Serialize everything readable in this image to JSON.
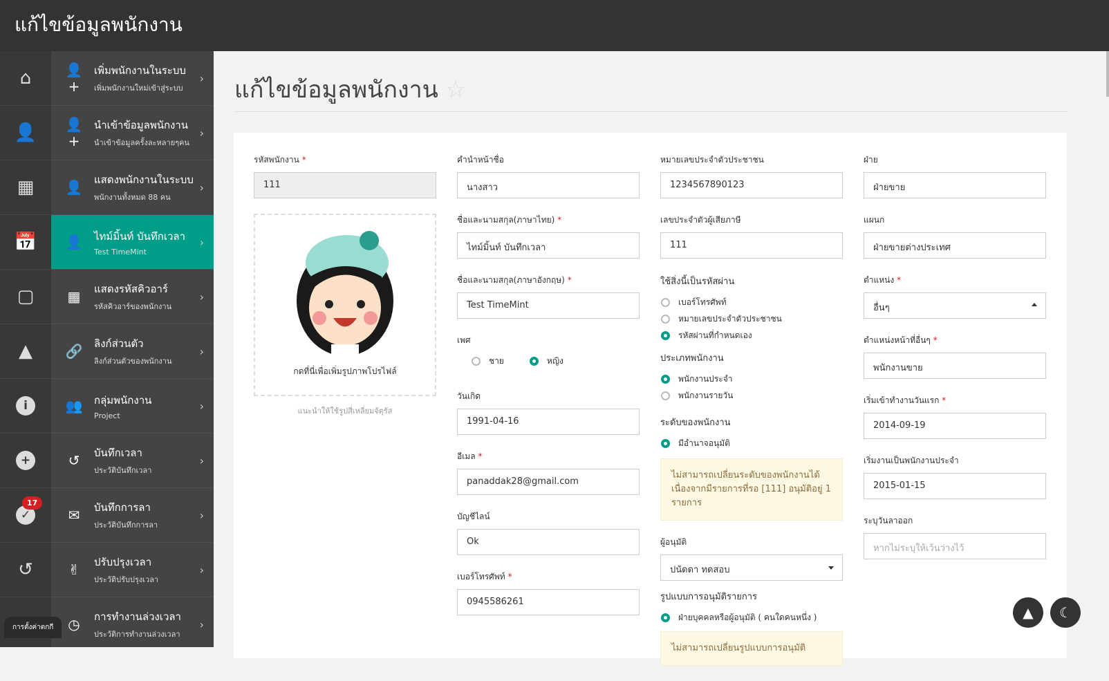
{
  "header": {
    "title": "แก้ไขข้อมูลพนักงาน"
  },
  "iconbar": {
    "badge": "17"
  },
  "menu": [
    {
      "title": "เพิ่มพนักงานในระบบ",
      "sub": "เพิ่มพนักงานใหม่เข้าสู่ระบบ",
      "icon": "👤+"
    },
    {
      "title": "นำเข้าข้อมูลพนักงาน",
      "sub": "นำเข้าข้อมูลครั้งละหลายๆคน",
      "icon": "👤+"
    },
    {
      "title": "แสดงพนักงานในระบบ",
      "sub": "พนักงานทั้งหมด 88 คน",
      "icon": "👤"
    },
    {
      "title": "ไทม์มิ้นท์ บันทึกเวลา",
      "sub": "Test TimeMint",
      "icon": "👤"
    },
    {
      "title": "แสดงรหัสคิวอาร์",
      "sub": "รหัสคิวอาร์ของพนักงาน",
      "icon": "▦"
    },
    {
      "title": "ลิงก์ส่วนตัว",
      "sub": "ลิงก์ส่วนตัวของพนักงาน",
      "icon": "🔗"
    },
    {
      "title": "กลุ่มพนักงาน",
      "sub": "Project",
      "icon": "👥"
    },
    {
      "title": "บันทึกเวลา",
      "sub": "ประวัติบันทึกเวลา",
      "icon": "↺"
    },
    {
      "title": "บันทึกการลา",
      "sub": "ประวัติบันทึกการลา",
      "icon": "✉"
    },
    {
      "title": "ปรับปรุงเวลา",
      "sub": "ประวัติปรับปรุงเวลา",
      "icon": "✌"
    },
    {
      "title": "การทำงานล่วงเวลา",
      "sub": "ประวัติการทำงานล่วงเวลา",
      "icon": "◷"
    }
  ],
  "tooltip": "การตั้งค่าตกกี",
  "page": {
    "title": "แก้ไขข้อมูลพนักงาน"
  },
  "form": {
    "emp_code": {
      "label": "รหัสพนักงาน",
      "value": "111"
    },
    "photo_text": "กดที่นี่เพื่อเพิ่มรูปภาพโปรไฟล์",
    "photo_hint": "แนะนำให้ใช้รูปสี่เหลี่ยมจัตุรัส",
    "prefix": {
      "label": "คำนำหน้าชื่อ",
      "value": "นางสาว"
    },
    "name_th": {
      "label": "ชื่อและนามสกุล(ภาษาไทย)",
      "value": "ไทม์มิ้นท์ บันทึกเวลา"
    },
    "name_en": {
      "label": "ชื่อและนามสกุล(ภาษาอังกฤษ)",
      "value": "Test TimeMint"
    },
    "gender": {
      "label": "เพศ",
      "male": "ชาย",
      "female": "หญิง"
    },
    "birthday": {
      "label": "วันเกิด",
      "value": "1991-04-16"
    },
    "email": {
      "label": "อีเมล",
      "value": "panaddak28@gmail.com"
    },
    "line": {
      "label": "บัญชีไลน์",
      "value": "Ok"
    },
    "phone": {
      "label": "เบอร์โทรศัพท์",
      "value": "0945586261"
    },
    "national_id": {
      "label": "หมายเลขประจำตัวประชาชน",
      "value": "1234567890123"
    },
    "tax_id": {
      "label": "เลขประจำตัวผู้เสียภาษี",
      "value": "111"
    },
    "password": {
      "label": "ใช้สิ่งนี้เป็นรหัสผ่าน",
      "options": [
        "เบอร์โทรศัพท์",
        "หมายเลขประจำตัวประชาชน",
        "รหัสผ่านที่กำหนดเอง"
      ]
    },
    "emp_type": {
      "label": "ประเภทพนักงาน",
      "options": [
        "พนักงานประจำ",
        "พนักงานรายวัน"
      ]
    },
    "level": {
      "label": "ระดับของพนักงาน",
      "option": "มีอำนาจอนุมัติ"
    },
    "level_warn": {
      "line1": "ไม่สามารถเปลี่ยนระดับของพนักงานได้",
      "line2": "เนื่องจากมีรายการที่รอ [111] อนุมัติอยู่ 1 รายการ"
    },
    "approver": {
      "label": "ผู้อนุมัติ",
      "value": "ปนัดดา ทดสอบ"
    },
    "approval_type": {
      "label": "รูปแบบการอนุมัติรายการ",
      "option": "ฝ่ายบุคคลหรือผู้อนุมัติ ( คนใดคนหนึ่ง )"
    },
    "approval_warn": "ไม่สามารถเปลี่ยนรูปแบบการอนุมัติ",
    "department": {
      "label": "ฝ่าย",
      "value": "ฝ่ายขาย"
    },
    "section": {
      "label": "แผนก",
      "value": "ฝ่ายขายต่างประเทศ"
    },
    "position": {
      "label": "ตำแหน่ง",
      "value": "อื่นๆ"
    },
    "position_other": {
      "label": "ตำแหน่งหน้าที่อื่นๆ",
      "value": "พนักงานขาย"
    },
    "start_date": {
      "label": "เริ่มเข้าทำงานวันแรก",
      "value": "2014-09-19"
    },
    "permanent_date": {
      "label": "เริ่มงานเป็นพนักงานประจำ",
      "value": "2015-01-15"
    },
    "resign_date": {
      "label": "ระบุวันลาออก",
      "placeholder": "หากไม่ระบุให้เว้นว่างไว้"
    }
  },
  "colors": {
    "accent": "#009e88",
    "dark": "#333333"
  }
}
